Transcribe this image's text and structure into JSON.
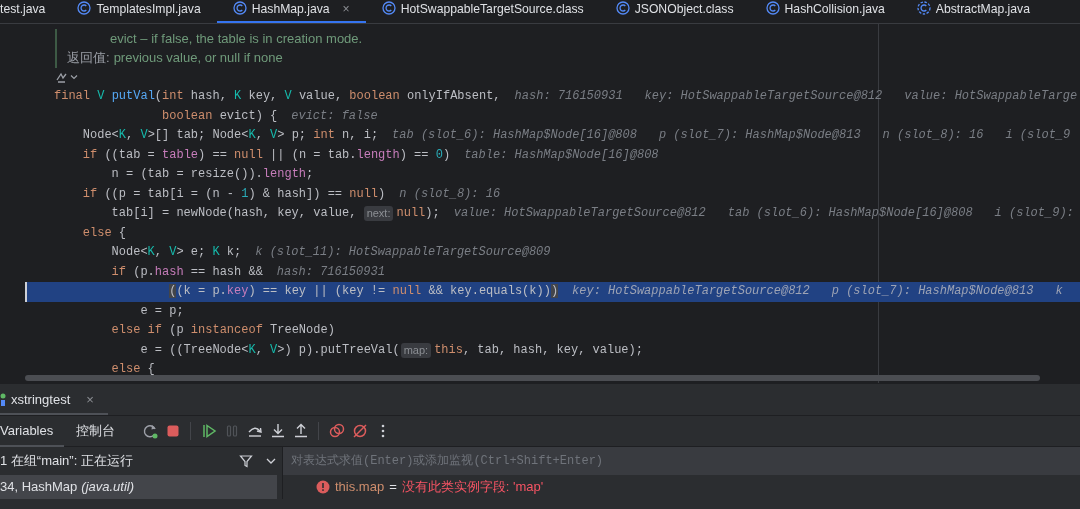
{
  "editor_tabs": [
    {
      "label": "test.java",
      "kind": "file",
      "selected": false
    },
    {
      "label": "TemplatesImpl.java",
      "kind": "class",
      "selected": false
    },
    {
      "label": "HashMap.java",
      "kind": "class",
      "selected": true,
      "close": "×"
    },
    {
      "label": "HotSwappableTargetSource.class",
      "kind": "class",
      "selected": false
    },
    {
      "label": "JSONObject.class",
      "kind": "class",
      "selected": false
    },
    {
      "label": "HashCollision.java",
      "kind": "class",
      "selected": false
    },
    {
      "label": "AbstractMap.java",
      "kind": "abstract_class",
      "selected": false
    }
  ],
  "editor": {
    "lines": [
      {
        "kind": "doc_param",
        "text": "evict – if false, the table is in creation mode."
      },
      {
        "kind": "doc_return",
        "label": "返回值:",
        "text": "previous value, or null if none"
      },
      {
        "kind": "gutter_icon"
      },
      {
        "kind": "code",
        "current": false,
        "tokens": [
          {
            "kind": "kw",
            "text": "final"
          },
          {
            "kind": "type",
            "text": "V"
          },
          {
            "kind": "method",
            "text": "putVal"
          },
          {
            "kind": "plain",
            "text": "("
          },
          {
            "kind": "kw",
            "text": "int"
          },
          {
            "kind": "plain",
            "text": "hash,"
          },
          {
            "kind": "type",
            "text": "K"
          },
          {
            "kind": "plain",
            "text": "key,"
          },
          {
            "kind": "type",
            "text": "V"
          },
          {
            "kind": "plain",
            "text": "value,"
          },
          {
            "kind": "kw",
            "text": "boolean"
          },
          {
            "kind": "plain",
            "text": "onlyIfAbsent,"
          }
        ],
        "values": [
          "hash: 716150931",
          "key: HotSwappableTargetSource@812",
          "value: HotSwappableTarge"
        ],
        "children": [
          {
            "kind": "param_continuation",
            "current": false,
            "tokens": [
              {
                "kind": "kw",
                "text": "boolean"
              },
              {
                "kind": "plain",
                "text": "evict) {"
              }
            ],
            "values": [
              "evict: false"
            ]
          },
          {
            "kind": "code",
            "current": false,
            "tokens": [
              {
                "kind": "plain",
                "text": "Node<"
              },
              {
                "kind": "type",
                "text": "K"
              },
              {
                "kind": "plain",
                "text": ","
              },
              {
                "kind": "type",
                "text": "V"
              },
              {
                "kind": "plain",
                "text": ">[] tab; Node<"
              },
              {
                "kind": "type",
                "text": "K"
              },
              {
                "kind": "plain",
                "text": ","
              },
              {
                "kind": "type",
                "text": "V"
              },
              {
                "kind": "plain",
                "text": "> p;"
              },
              {
                "kind": "kw",
                "text": "int"
              },
              {
                "kind": "plain",
                "text": "n, i;"
              }
            ],
            "values": [
              "tab (slot_6): HashMap$Node[16]@808",
              "p (slot_7): HashMap$Node@813",
              "n (slot_8): 16",
              "i (slot_9"
            ]
          },
          {
            "kind": "code",
            "current": false,
            "tokens": [
              {
                "kind": "kw",
                "text": "if"
              },
              {
                "kind": "plain",
                "text": "((tab ="
              },
              {
                "kind": "field",
                "text": "table"
              },
              {
                "kind": "plain",
                "text": ") =="
              },
              {
                "kind": "kw",
                "text": "null"
              },
              {
                "kind": "plain",
                "text": "|| (n = tab."
              },
              {
                "kind": "field",
                "text": "length"
              },
              {
                "kind": "plain",
                "text": ") =="
              },
              {
                "kind": "num",
                "text": "0"
              },
              {
                "kind": "plain",
                "text": ")"
              }
            ],
            "values": [
              "table: HashMap$Node[16]@808"
            ],
            "children": [
              {
                "kind": "code",
                "current": false,
                "tokens": [
                  {
                    "kind": "plain",
                    "text": "n = (tab = resize())."
                  },
                  {
                    "kind": "field",
                    "text": "length"
                  },
                  {
                    "kind": "plain",
                    "text": ";"
                  }
                ]
              }
            ]
          },
          {
            "kind": "code",
            "current": false,
            "tokens": [
              {
                "kind": "kw",
                "text": "if"
              },
              {
                "kind": "plain",
                "text": "((p = tab[i = (n -"
              },
              {
                "kind": "num",
                "text": "1"
              },
              {
                "kind": "plain",
                "text": ") & hash]) =="
              },
              {
                "kind": "kw",
                "text": "null"
              },
              {
                "kind": "plain",
                "text": ")"
              }
            ],
            "values": [
              "n (slot_8): 16"
            ],
            "children": [
              {
                "kind": "code",
                "current": false,
                "tokens": [
                  {
                    "kind": "plain",
                    "text": "tab[i] = newNode(hash, key, value,"
                  },
                  {
                    "kind": "hint",
                    "text": "next:"
                  },
                  {
                    "kind": "kw",
                    "text": "null"
                  },
                  {
                    "kind": "plain",
                    "text": ");"
                  }
                ],
                "values": [
                  "value: HotSwappableTargetSource@812",
                  "tab (slot_6): HashMap$Node[16]@808",
                  "i (slot_9):"
                ]
              }
            ]
          },
          {
            "kind": "code",
            "current": false,
            "tokens": [
              {
                "kind": "kw",
                "text": "else"
              },
              {
                "kind": "plain",
                "text": "{"
              }
            ],
            "children": [
              {
                "kind": "code",
                "current": false,
                "tokens": [
                  {
                    "kind": "plain",
                    "text": "Node<"
                  },
                  {
                    "kind": "type",
                    "text": "K"
                  },
                  {
                    "kind": "plain",
                    "text": ","
                  },
                  {
                    "kind": "type",
                    "text": "V"
                  },
                  {
                    "kind": "plain",
                    "text": "> e;"
                  },
                  {
                    "kind": "type",
                    "text": "K"
                  },
                  {
                    "kind": "plain",
                    "text": "k;"
                  }
                ],
                "values": [
                  "k (slot_11): HotSwappableTargetSource@809"
                ]
              },
              {
                "kind": "code",
                "current": false,
                "tokens": [
                  {
                    "kind": "kw",
                    "text": "if"
                  },
                  {
                    "kind": "plain",
                    "text": "(p."
                  },
                  {
                    "kind": "field",
                    "text": "hash"
                  },
                  {
                    "kind": "plain",
                    "text": "== hash &&"
                  }
                ],
                "values": [
                  "hash: 716150931"
                ],
                "children": [
                  {
                    "kind": "continuation",
                    "current": true,
                    "tokens": [
                      {
                        "kind": "match",
                        "text": "("
                      },
                      {
                        "kind": "plain",
                        "text": "(k = p."
                      },
                      {
                        "kind": "field",
                        "text": "key"
                      },
                      {
                        "kind": "plain",
                        "text": ") == key || (key !="
                      },
                      {
                        "kind": "kw",
                        "text": "null"
                      },
                      {
                        "kind": "plain",
                        "text": "&& key.equals(k))"
                      },
                      {
                        "kind": "match",
                        "text": ")"
                      }
                    ],
                    "values": [
                      "key: HotSwappableTargetSource@812",
                      "p (slot_7): HashMap$Node@813",
                      "k"
                    ]
                  },
                  {
                    "kind": "code",
                    "current": false,
                    "tokens": [
                      {
                        "kind": "plain",
                        "text": "e = p;"
                      }
                    ]
                  }
                ]
              },
              {
                "kind": "code",
                "current": false,
                "tokens": [
                  {
                    "kind": "kw",
                    "text": "else if"
                  },
                  {
                    "kind": "plain",
                    "text": "(p"
                  },
                  {
                    "kind": "kw",
                    "text": "instanceof"
                  },
                  {
                    "kind": "plain",
                    "text": "TreeNode)"
                  }
                ],
                "children": [
                  {
                    "kind": "code",
                    "current": false,
                    "tokens": [
                      {
                        "kind": "plain",
                        "text": "e = ((TreeNode<"
                      },
                      {
                        "kind": "type",
                        "text": "K"
                      },
                      {
                        "kind": "plain",
                        "text": ","
                      },
                      {
                        "kind": "type",
                        "text": "V"
                      },
                      {
                        "kind": "plain",
                        "text": ">) p).putTreeVal("
                      },
                      {
                        "kind": "hint",
                        "text": "map:"
                      },
                      {
                        "kind": "kw",
                        "text": "this"
                      },
                      {
                        "kind": "plain",
                        "text": ", tab, hash, key, value);"
                      }
                    ]
                  }
                ]
              },
              {
                "kind": "code",
                "current": false,
                "tokens": [
                  {
                    "kind": "kw",
                    "text": "else"
                  },
                  {
                    "kind": "plain",
                    "text": "{"
                  }
                ]
              }
            ]
          }
        ]
      }
    ]
  },
  "debug_panel": {
    "tabs": [
      {
        "label": "xstringtest",
        "close": "×",
        "selected": true
      }
    ],
    "views": [
      {
        "label": "Variables",
        "selected": true
      },
      {
        "label": "控制台",
        "selected": false
      }
    ],
    "button_groups": [
      [
        {
          "kind": "rerun",
          "disabled": false
        },
        {
          "kind": "stop",
          "disabled": false
        }
      ],
      [
        {
          "kind": "resume",
          "disabled": false
        },
        {
          "kind": "pause",
          "disabled": true
        },
        {
          "kind": "step_over",
          "disabled": false
        },
        {
          "kind": "step_into",
          "disabled": false
        },
        {
          "kind": "step_out",
          "disabled": false
        }
      ],
      [
        {
          "kind": "view_breakpoints",
          "disabled": false
        },
        {
          "kind": "mute_breakpoints",
          "disabled": false
        },
        {
          "kind": "more",
          "disabled": false
        }
      ]
    ],
    "frames": {
      "header": "1 在组“main”: 正在运行",
      "rows": [
        {
          "method": "34, HashMap",
          "class": "(java.util)",
          "selected": true
        }
      ]
    },
    "evaluate": {
      "placeholder": "对表达式求值(Enter)或添加监视(Ctrl+Shift+Enter)"
    },
    "variables": [
      {
        "kind": "error",
        "name": "this.map",
        "separator": "=",
        "value": "没有此类实例字段: 'map'"
      }
    ]
  }
}
